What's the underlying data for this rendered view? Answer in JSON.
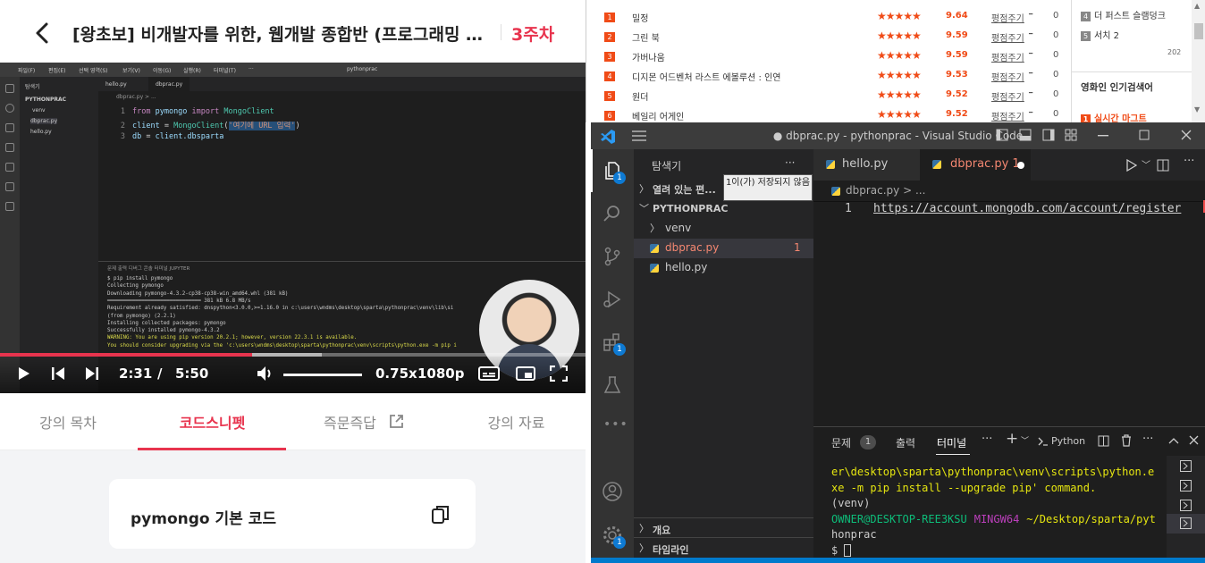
{
  "lecture": {
    "title": "[왕초보] 비개발자를 위한, 웹개발 종합반 (프로그래밍 실무...",
    "week": "3주차",
    "player": {
      "current_time": "2:31",
      "separator": "/",
      "duration": "5:50",
      "speed": "0.75x",
      "quality": "1080p",
      "progress": 0.431,
      "buffered": 0.55,
      "volume": 1.0
    },
    "tabs": [
      "강의 목차",
      "코드스니펫",
      "즉문즉답",
      "강의 자료"
    ],
    "active_tab": "코드스니펫",
    "snippet_title": "pymongo 기본 코드"
  },
  "video_content": {
    "title_menu": [
      "파일(F)",
      "편집(E)",
      "선택 영역(S)",
      "보기(V)",
      "이동(G)",
      "실행(R)",
      "터미널(T)",
      "···"
    ],
    "title_search": "pythonprac",
    "side_header": "탐색기",
    "side_items": [
      "PYTHONPRAC",
      "venv",
      "dbprac.py",
      "hello.py"
    ],
    "tabs": [
      "hello.py",
      "dbprac.py"
    ],
    "breadcrumb": "dbprac.py > ...",
    "code": [
      {
        "n": "1",
        "parts": [
          [
            "kw",
            "from "
          ],
          [
            "",
            "pymongo "
          ],
          [
            "kw",
            "import "
          ],
          [
            "cl",
            "MongoClient"
          ]
        ]
      },
      {
        "n": "2",
        "parts": [
          [
            "",
            "client "
          ],
          [
            "op",
            "= "
          ],
          [
            "cl",
            "MongoClient"
          ],
          [
            "op",
            "("
          ],
          [
            "st",
            "'여기에 URL 입력'"
          ],
          [
            "op",
            ")"
          ]
        ]
      },
      {
        "n": "3",
        "parts": [
          [
            "",
            "db "
          ],
          [
            "op",
            "= "
          ],
          [
            "",
            "client.dbsparta"
          ]
        ]
      }
    ],
    "panel_tabs": "문제   출력   디버그 콘솔   터미널   JUPYTER",
    "terminal": [
      {
        "c": "",
        "t": "$ pip install pymongo"
      },
      {
        "c": "",
        "t": "Collecting pymongo"
      },
      {
        "c": "",
        "t": "  Downloading pymongo-4.3.2-cp38-cp38-win_amd64.whl (381 kB)"
      },
      {
        "c": "",
        "t": "     ━━━━━━━━━━━━━━━━━━━━━━━━━━━━━━ 381 kB 6.8 MB/s"
      },
      {
        "c": "",
        "t": "Requirement already satisfied: dnspython<3.0.0,>=1.16.0 in c:\\users\\wndms\\desktop\\sparta\\pythonprac\\venv\\lib\\si"
      },
      {
        "c": "",
        "t": "(from pymongo) (2.2.1)"
      },
      {
        "c": "",
        "t": "Installing collected packages: pymongo"
      },
      {
        "c": "",
        "t": "Successfully installed pymongo-4.3.2"
      },
      {
        "c": "yl",
        "t": "WARNING: You are using pip version 20.2.1; however, version 22.3.1 is available."
      },
      {
        "c": "yl",
        "t": "You should consider upgrading via the 'c:\\users\\wndms\\desktop\\sparta\\pythonprac\\venv\\scripts\\python.exe -m pip i"
      }
    ]
  },
  "ranking": {
    "rows": [
      {
        "rank": "1",
        "title": "밀정",
        "score": "9.64",
        "eval": "평점주기",
        "a": "0"
      },
      {
        "rank": "2",
        "title": "그린 북",
        "score": "9.59",
        "eval": "평점주기",
        "a": "0"
      },
      {
        "rank": "3",
        "title": "가버나움",
        "score": "9.59",
        "eval": "평점주기",
        "a": "0"
      },
      {
        "rank": "4",
        "title": "디지몬 어드벤처 라스트 에볼루션 : 인연",
        "score": "9.53",
        "eval": "평점주기",
        "a": "0"
      },
      {
        "rank": "5",
        "title": "원더",
        "score": "9.52",
        "eval": "평점주기",
        "a": "0"
      },
      {
        "rank": "6",
        "title": "베일리 어게인",
        "score": "9.52",
        "eval": "평점주기",
        "a": "0"
      }
    ],
    "stars": "★★★★★",
    "side": {
      "item4_num": "4",
      "item4": "더 퍼스트 슬램덩크",
      "item5_num": "5",
      "item5": "서치 2",
      "date": "202",
      "heading": "영화인 인기검색어",
      "live_num": "1",
      "live": "실시간 마그트"
    }
  },
  "vscode": {
    "title": "● dbprac.py - pythonprac - Visual Studio Code",
    "explorer": "탐색기",
    "open_editors": "열려 있는 편...",
    "unsaved_tooltip": "1이(가) 저장되지 않음",
    "folder": "PYTHONPRAC",
    "files": [
      "venv",
      "dbprac.py",
      "hello.py"
    ],
    "dbprac_problems": "1",
    "outline": "개요",
    "timeline": "타임라인",
    "tabs": [
      "hello.py",
      "dbprac.py 1"
    ],
    "breadcrumb_file": "dbprac.py",
    "breadcrumb_more": "> ...",
    "line_no": "1",
    "code_line": "https://account.mongodb.com/account/register",
    "panel_tabs": [
      "문제",
      "출력",
      "터미널"
    ],
    "problems_count": "1",
    "shell": "Python",
    "explorer_badge": "1",
    "ext_badge": "1",
    "settings_badge": "1",
    "terminal": [
      {
        "c": "#e5e510",
        "t": "er\\desktop\\sparta\\pythonprac\\venv\\scripts\\python.e"
      },
      {
        "c": "#e5e510",
        "t": "xe -m pip install --upgrade pip' command."
      },
      {
        "c": "#cccccc",
        "t": "(venv)"
      },
      {
        "c": "",
        "t": ""
      },
      {
        "c": "#cccccc",
        "t": "honprac"
      },
      {
        "c": "#cccccc",
        "t": "$ "
      }
    ],
    "prompt_user": "OWNER@DESKTOP-REE3KSU",
    "prompt_env": "MINGW64",
    "prompt_path": "~/Desktop/sparta/pyt",
    "colors": {
      "user": "#0dbc79",
      "env": "#bc3fbc",
      "path": "#e5e510",
      "accent": "#0e7ad3",
      "modified": "#f14c4c"
    }
  },
  "colors": {
    "brand": "#e8344e",
    "rank": "#f04b17"
  }
}
